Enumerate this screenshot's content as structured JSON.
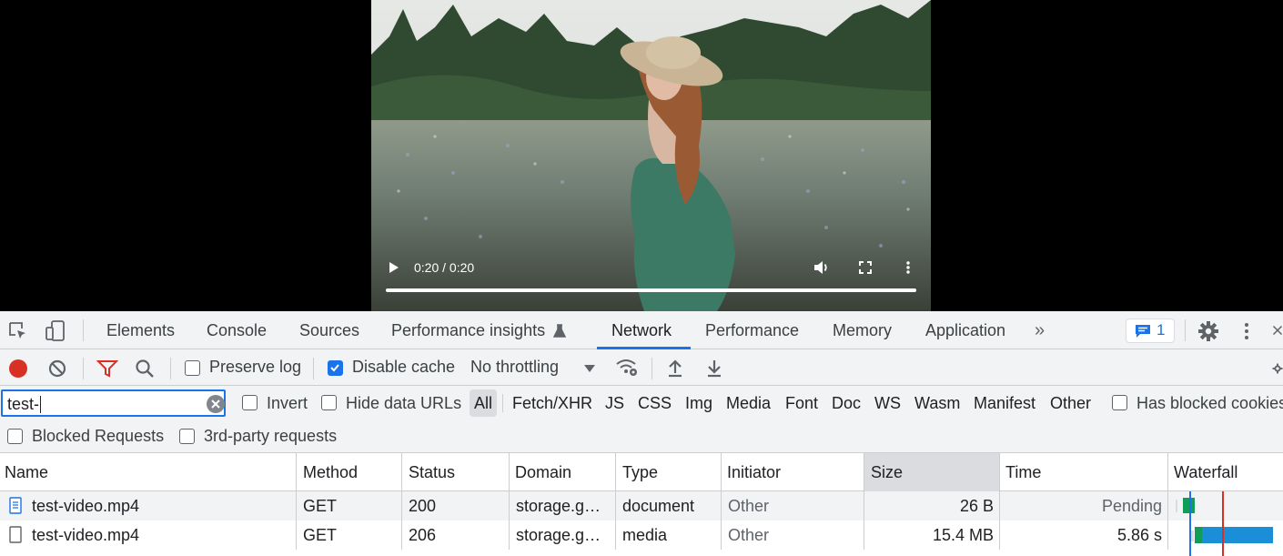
{
  "video": {
    "time": "0:20 / 0:20"
  },
  "tabs": {
    "items": [
      "Elements",
      "Console",
      "Sources",
      "Performance insights",
      "Network",
      "Performance",
      "Memory",
      "Application"
    ],
    "active": "Network",
    "more": "»",
    "issues_count": "1"
  },
  "toolbar": {
    "preserve_log": "Preserve log",
    "disable_cache": "Disable cache",
    "throttling": "No throttling"
  },
  "filter": {
    "value": "test-",
    "invert": "Invert",
    "hide_data_urls": "Hide data URLs",
    "types": [
      "All",
      "Fetch/XHR",
      "JS",
      "CSS",
      "Img",
      "Media",
      "Font",
      "Doc",
      "WS",
      "Wasm",
      "Manifest",
      "Other"
    ],
    "has_blocked_cookies": "Has blocked cookies",
    "blocked_requests": "Blocked Requests",
    "third_party": "3rd-party requests"
  },
  "table": {
    "columns": [
      "Name",
      "Method",
      "Status",
      "Domain",
      "Type",
      "Initiator",
      "Size",
      "Time",
      "Waterfall"
    ],
    "rows": [
      {
        "name": "test-video.mp4",
        "method": "GET",
        "status": "200",
        "domain": "storage.g…",
        "type": "document",
        "initiator": "Other",
        "size": "26 B",
        "time": "Pending"
      },
      {
        "name": "test-video.mp4",
        "method": "GET",
        "status": "206",
        "domain": "storage.g…",
        "type": "media",
        "initiator": "Other",
        "size": "15.4 MB",
        "time": "5.86 s"
      }
    ]
  },
  "colors": {
    "accent": "#1a73e8",
    "record": "#d93025",
    "filter_active": "#d93025"
  }
}
